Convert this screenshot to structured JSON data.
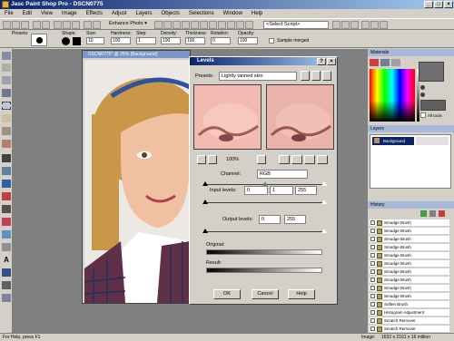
{
  "window": {
    "title": "Jasc Paint Shop Pro - DSCN0775"
  },
  "menu": [
    "File",
    "Edit",
    "View",
    "Image",
    "Effects",
    "Adjust",
    "Layers",
    "Objects",
    "Selections",
    "Window",
    "Help"
  ],
  "toolbar": {
    "enhance": "Enhance Photo ▾",
    "script": "<Select Script>"
  },
  "tool_options": {
    "presets_label": "Presets:",
    "shape_label": "Shape:",
    "size_label": "Size:",
    "size": "10",
    "hardness_label": "Hardness:",
    "hardness": "100",
    "step_label": "Step:",
    "step": "1",
    "density_label": "Density:",
    "density": "100",
    "thickness_label": "Thickness:",
    "thickness": "100",
    "rotation_label": "Rotation:",
    "rotation": "0",
    "opacity_label": "Opacity:",
    "opacity": "100",
    "sample_merged": "Sample merged"
  },
  "document": {
    "title": "DSCN0775* @ 25% (Background)"
  },
  "levels": {
    "title": "Levels",
    "presets_label": "Presets:",
    "preset_value": "Lightly tanned skin",
    "zoom": "100%",
    "channel_label": "Channel:",
    "channel_value": "RGB",
    "input_label": "Input levels:",
    "input_low": "0",
    "input_gamma": "1",
    "input_high": "255",
    "output_label": "Output levels:",
    "output_low": "0",
    "output_high": "255",
    "original_label": "Original:",
    "result_label": "Result:",
    "ok": "OK",
    "cancel": "Cancel",
    "help": "Help"
  },
  "materials": {
    "title": "Materials",
    "all_tools": "All tools"
  },
  "layers": {
    "title": "Layers",
    "background": "Background"
  },
  "history": {
    "title": "History",
    "items": [
      "Smudge Brush",
      "Smudge Brush",
      "Smudge Brush",
      "Smudge Brush",
      "Smudge Brush",
      "Smudge Brush",
      "Smudge Brush",
      "Smudge Brush",
      "Smudge Brush",
      "Smudge Brush",
      "Soften Brush",
      "Histogram Adjustment",
      "Scratch Remover",
      "Scratch Remover"
    ]
  },
  "status": {
    "left": "For Help, press F1",
    "image_label": "Image:",
    "image_info": "1632 x 2161 x 16 million"
  }
}
